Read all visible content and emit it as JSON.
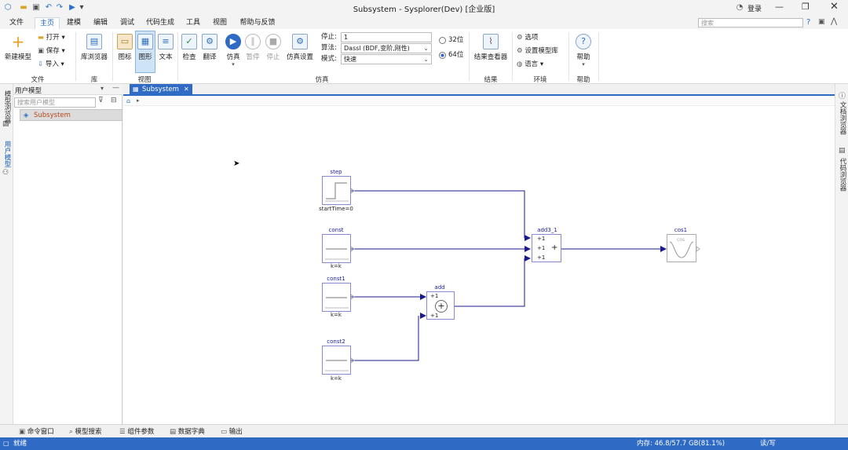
{
  "app": {
    "title": "Subsystem - Sysplorer(Dev) [企业版]",
    "login": "登录"
  },
  "menu": [
    "文件",
    "主页",
    "建模",
    "编辑",
    "调试",
    "代码生成",
    "工具",
    "视图",
    "帮助与反馈"
  ],
  "search": {
    "placeholder": "搜索"
  },
  "ribbon": {
    "new_model": "新建模型",
    "open": "打开",
    "save": "保存",
    "import": "导入",
    "group_file": "文件",
    "library_browser": "库浏览器",
    "group_library": "库",
    "view_icon": "图标",
    "view_graphic": "图形",
    "view_text": "文本",
    "group_view": "视图",
    "check": "检查",
    "translate": "翻译",
    "simulate": "仿真",
    "pause": "暂停",
    "stop": "停止",
    "sim_settings": "仿真设置",
    "stop_label": "停止:",
    "stop_value": "1",
    "algo_label": "算法:",
    "algo_value": "Dassl (BDF,变阶,刚性)",
    "mode_label": "模式:",
    "mode_value": "快速",
    "bit32": "32位",
    "bit64": "64位",
    "group_sim": "仿真",
    "result_viewer": "结果查看器",
    "group_result": "结果",
    "options": "选项",
    "set_model_lib": "设置模型库",
    "language": "语言",
    "group_env": "环境",
    "help": "帮助",
    "group_help": "帮助"
  },
  "left_panel": {
    "title": "用户模型",
    "search_placeholder": "搜索用户模型",
    "tree_item": "Subsystem"
  },
  "left_strip": {
    "tab1": "模型浏览器",
    "tab2": "用户模型"
  },
  "right_strip": {
    "tab1": "文档浏览器",
    "tab2": "代码浏览器"
  },
  "doc_tab": {
    "label": "Subsystem"
  },
  "blocks": {
    "step": {
      "name": "step",
      "param": "startTime=0"
    },
    "const": {
      "name": "const",
      "param": "k=k"
    },
    "const1": {
      "name": "const1",
      "param": "k=k"
    },
    "const2": {
      "name": "const2",
      "param": "k=k"
    },
    "add": {
      "name": "add",
      "in1": "+1",
      "in2": "+1"
    },
    "add3": {
      "name": "add3_1",
      "in1": "+1",
      "in2": "+1",
      "in3": "+1"
    },
    "cos": {
      "name": "cos1",
      "inner": "cos"
    }
  },
  "bottom_tabs": [
    "命令窗口",
    "模型搜索",
    "组件参数",
    "数据字典",
    "输出"
  ],
  "status": {
    "left": "就绪",
    "memory": "内存: 46.8/57.7 GB(81.1%)",
    "mode": "读/写"
  },
  "colors": {
    "accent": "#2f6bc5",
    "wire": "#1a1a8c",
    "block_border": "#8a8ad0"
  }
}
